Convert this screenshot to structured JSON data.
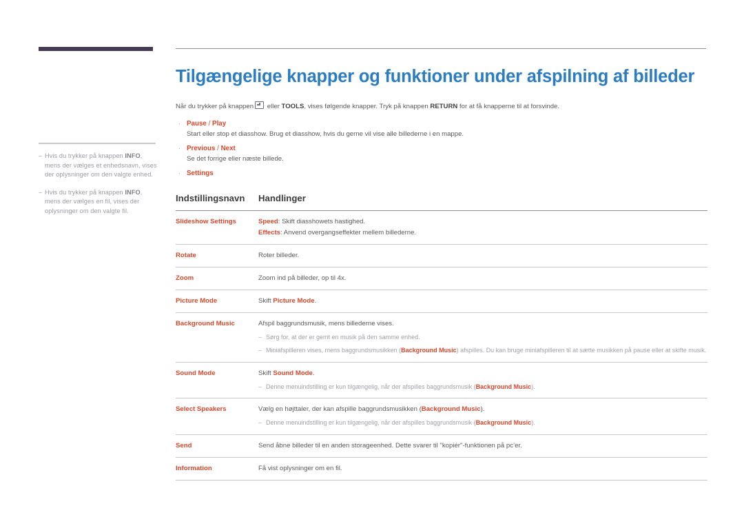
{
  "decor": {
    "accent_bar_color": "#453a53",
    "title_color": "#2c7cc1",
    "orange_accent": "#d9472b"
  },
  "sidebar": {
    "notes": [
      {
        "dash": "–",
        "pre": "Hvis du trykker på knappen ",
        "bold": "INFO",
        "post": ", mens der vælges et enhedsnavn, vises der oplysninger om den valgte enhed."
      },
      {
        "dash": "–",
        "pre": "Hvis du trykker på knappen ",
        "bold": "INFO",
        "post": ", mens der vælges en fil, vises der oplysninger om den valgte fil."
      }
    ]
  },
  "main": {
    "title": "Tilgængelige knapper og funktioner under afspilning af billeder",
    "intro": {
      "part1": "Når du trykker på knappen",
      "key_icon": "enter-key-icon",
      "part2": " eller ",
      "bold1": "TOOLS",
      "part3": ", vises følgende knapper. Tryk på knappen ",
      "bold2": "RETURN",
      "part4": " for at få knapperne til at forsvinde."
    },
    "bullets": [
      {
        "marker": "·",
        "label_a": "Pause",
        "label_sep": " / ",
        "label_b": "Play",
        "desc": "Start eller stop et diasshow. Brug et diasshow, hvis du gerne vil vise alle billederne i en mappe."
      },
      {
        "marker": "·",
        "label_a": "Previous",
        "label_sep": " / ",
        "label_b": "Next",
        "desc": "Se det forrige eller næste billede."
      },
      {
        "marker": "·",
        "label_a": "Settings",
        "label_sep": "",
        "label_b": "",
        "desc": ""
      }
    ],
    "table": {
      "headers": {
        "name": "Indstillingsnavn",
        "action": "Handlinger"
      },
      "rows": [
        {
          "name": "Slideshow Settings",
          "lines": [
            {
              "accent": "Speed",
              "text": ": Skift diasshowets hastighed."
            },
            {
              "accent": "Effects",
              "text": ": Anvend overgangseffekter mellem billederne."
            }
          ],
          "subnotes": []
        },
        {
          "name": "Rotate",
          "lines": [
            {
              "accent": "",
              "text": "Roter billeder."
            }
          ],
          "subnotes": []
        },
        {
          "name": "Zoom",
          "lines": [
            {
              "accent": "",
              "text": "Zoom ind på billeder, op til 4x."
            }
          ],
          "subnotes": []
        },
        {
          "name": "Picture Mode",
          "lines": [
            {
              "pre": "Skift ",
              "accent": "Picture Mode",
              "text": "."
            }
          ],
          "subnotes": []
        },
        {
          "name": "Background Music",
          "lines": [
            {
              "accent": "",
              "text": "Afspil baggrundsmusik, mens billederne vises."
            }
          ],
          "subnotes": [
            {
              "dash": "–",
              "pre": "Sørg for, at der er gemt en musik på den samme enhed.",
              "accent": "",
              "post": ""
            },
            {
              "dash": "–",
              "pre": "Miniafspilleren vises, mens baggrundsmusikken (",
              "accent": "Background Music",
              "post": ") afspilles. Du kan bruge miniafspilleren til at sætte musikken på pause eller at skifte musik."
            }
          ]
        },
        {
          "name": "Sound Mode",
          "lines": [
            {
              "pre": "Skift ",
              "accent": "Sound Mode",
              "text": "."
            }
          ],
          "subnotes": [
            {
              "dash": "–",
              "pre": "Denne menuindstilling er kun tilgængelig, når der afspilles baggrundsmusik (",
              "accent": "Background Music",
              "post": ")."
            }
          ]
        },
        {
          "name": "Select Speakers",
          "lines": [
            {
              "pre": "Vælg en højttaler, der kan afspille baggrundsmusikken (",
              "accent": "Background Music",
              "text": ")."
            }
          ],
          "subnotes": [
            {
              "dash": "–",
              "pre": "Denne menuindstilling er kun tilgængelig, når der afspilles baggrundsmusik (",
              "accent": "Background Music",
              "post": ")."
            }
          ]
        },
        {
          "name": "Send",
          "lines": [
            {
              "accent": "",
              "text": "Send åbne billeder til en anden storageenhed. Dette svarer til \"kopiér\"-funktionen på pc’er."
            }
          ],
          "subnotes": []
        },
        {
          "name": "Information",
          "lines": [
            {
              "accent": "",
              "text": "Få vist oplysninger om en fil."
            }
          ],
          "subnotes": []
        }
      ]
    }
  }
}
